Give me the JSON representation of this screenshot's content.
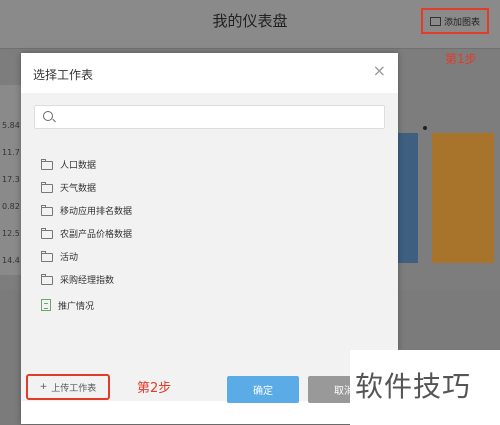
{
  "dashboard": {
    "title": "我的仪表盘",
    "add_chart_label": "添加图表",
    "step1_label": "第1步",
    "left_values": [
      "5.84",
      "11.7",
      "17.3",
      "0.82",
      "12.5",
      "14.4"
    ]
  },
  "modal": {
    "title": "选择工作表",
    "close_glyph": "×",
    "search_placeholder": "",
    "items": [
      {
        "label": "人口数据",
        "icon": "folder-icon"
      },
      {
        "label": "天气数据",
        "icon": "folder-icon"
      },
      {
        "label": "移动应用排名数据",
        "icon": "folder-icon"
      },
      {
        "label": "农副产品价格数据",
        "icon": "folder-icon"
      },
      {
        "label": "活动",
        "icon": "folder-icon"
      },
      {
        "label": "采购经理指数",
        "icon": "folder-icon"
      },
      {
        "label": "推广情况",
        "icon": "sheet-icon"
      }
    ],
    "upload_label": "上传工作表",
    "upload_plus": "+",
    "step2_label": "第2步",
    "ok_label": "确定",
    "cancel_label": "取消"
  },
  "watermark": "软件技巧",
  "colors": {
    "accent": "#5aabe6",
    "highlight": "#e23b2a",
    "bar_blue": "#3f5f80",
    "bar_orange": "#a8732b"
  }
}
